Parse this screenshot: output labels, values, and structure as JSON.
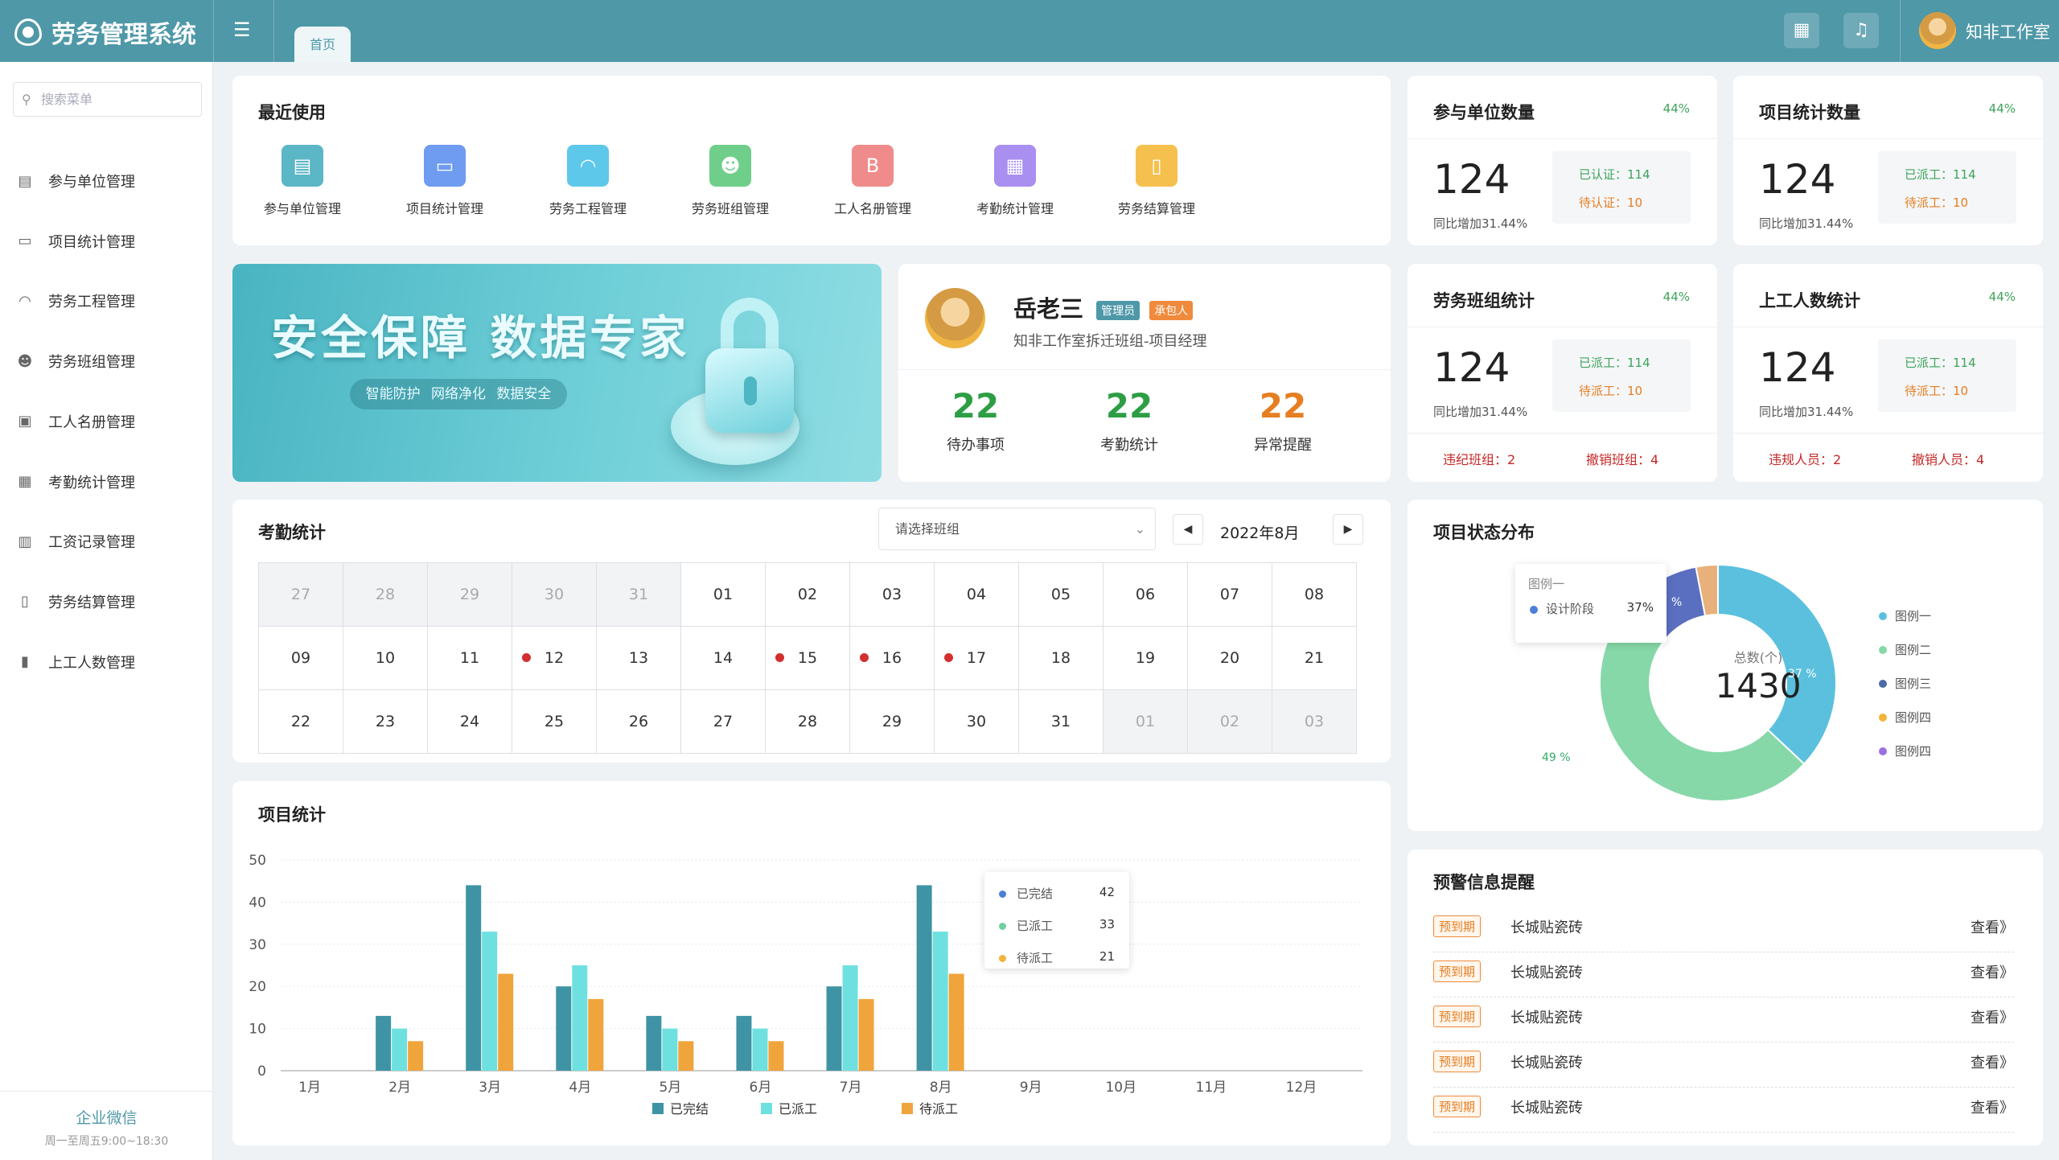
{
  "app": {
    "title": "劳务管理系统",
    "home_tab": "首页",
    "user_name": "知非工作室"
  },
  "sidebar": {
    "search_placeholder": "搜索菜单",
    "items": [
      {
        "label": "参与单位管理",
        "icon": "building-icon"
      },
      {
        "label": "项目统计管理",
        "icon": "folder-icon"
      },
      {
        "label": "劳务工程管理",
        "icon": "helmet-icon"
      },
      {
        "label": "劳务班组管理",
        "icon": "group-icon"
      },
      {
        "label": "工人名册管理",
        "icon": "roster-icon"
      },
      {
        "label": "考勤统计管理",
        "icon": "calendar-icon"
      },
      {
        "label": "工资记录管理",
        "icon": "salary-icon"
      },
      {
        "label": "劳务结算管理",
        "icon": "settlement-icon"
      },
      {
        "label": "上工人数管理",
        "icon": "bar-chart-icon"
      }
    ],
    "footer_title": "企业微信",
    "footer_hours": "周一至周五9:00~18:30"
  },
  "recent": {
    "title": "最近使用",
    "items": [
      {
        "label": "参与单位管理",
        "color": "#5bb6c6"
      },
      {
        "label": "项目统计管理",
        "color": "#6f9cf0"
      },
      {
        "label": "劳务工程管理",
        "color": "#5ec8ea"
      },
      {
        "label": "劳务班组管理",
        "color": "#6fcf8a"
      },
      {
        "label": "工人名册管理",
        "color": "#ef8b8b"
      },
      {
        "label": "考勤统计管理",
        "color": "#a88ff0"
      },
      {
        "label": "劳务结算管理",
        "color": "#f5c04d"
      }
    ]
  },
  "banner": {
    "title": "安全保障  数据专家",
    "pill": "智能防护 网络净化 数据安全"
  },
  "profile": {
    "name": "岳老三",
    "tag1": "管理员",
    "tag2": "承包人",
    "org": "知非工作室拆迁班组-项目经理",
    "stats": [
      {
        "value": "22",
        "label": "待办事项",
        "color": "#2e9e45"
      },
      {
        "value": "22",
        "label": "考勤统计",
        "color": "#2e9e45"
      },
      {
        "value": "22",
        "label": "异常提醒",
        "color": "#e67e22"
      }
    ]
  },
  "kpi": [
    {
      "title": "参与单位数量",
      "pct": "44%",
      "value": "124",
      "sub": "同比增加31.44%",
      "g": "已认证：114",
      "o": "待认证：10"
    },
    {
      "title": "项目统计数量",
      "pct": "44%",
      "value": "124",
      "sub": "同比增加31.44%",
      "g": "已派工：114",
      "o": "待派工：10"
    },
    {
      "title": "劳务班组统计",
      "pct": "44%",
      "value": "124",
      "sub": "同比增加31.44%",
      "g": "已派工：114",
      "o": "待派工：10",
      "b1": "违纪班组：2",
      "b2": "撤销班组：4"
    },
    {
      "title": "上工人数统计",
      "pct": "44%",
      "value": "124",
      "sub": "同比增加31.44%",
      "g": "已派工：114",
      "o": "待派工：10",
      "b1": "违规人员：2",
      "b2": "撤销人员：4"
    }
  ],
  "attendance": {
    "title": "考勤统计",
    "select_placeholder": "请选择班组",
    "month": "2022年8月",
    "rows": [
      [
        {
          "d": "27",
          "dim": true
        },
        {
          "d": "28",
          "dim": true
        },
        {
          "d": "29",
          "dim": true
        },
        {
          "d": "30",
          "dim": true
        },
        {
          "d": "31",
          "dim": true
        },
        {
          "d": "01"
        },
        {
          "d": "02"
        },
        {
          "d": "03"
        },
        {
          "d": "04"
        },
        {
          "d": "05"
        },
        {
          "d": "06"
        },
        {
          "d": "07"
        },
        {
          "d": "08"
        }
      ],
      [
        {
          "d": "09"
        },
        {
          "d": "10"
        },
        {
          "d": "11"
        },
        {
          "d": "12",
          "dot": true
        },
        {
          "d": "13"
        },
        {
          "d": "14"
        },
        {
          "d": "15",
          "dot": true
        },
        {
          "d": "16",
          "dot": true
        },
        {
          "d": "17",
          "dot": true
        },
        {
          "d": "18"
        },
        {
          "d": "19"
        },
        {
          "d": "20"
        },
        {
          "d": "21"
        }
      ],
      [
        {
          "d": "22"
        },
        {
          "d": "23"
        },
        {
          "d": "24"
        },
        {
          "d": "25"
        },
        {
          "d": "26"
        },
        {
          "d": "27"
        },
        {
          "d": "28"
        },
        {
          "d": "29"
        },
        {
          "d": "30"
        },
        {
          "d": "31"
        },
        {
          "d": "01",
          "dim": true
        },
        {
          "d": "02",
          "dim": true
        },
        {
          "d": "03",
          "dim": true
        }
      ]
    ]
  },
  "project_chart": {
    "title": "项目统计",
    "tooltip": [
      {
        "name": "已完结",
        "value": "42",
        "color": "#4a80d8"
      },
      {
        "name": "已派工",
        "value": "33",
        "color": "#6fd0a0"
      },
      {
        "name": "待派工",
        "value": "21",
        "color": "#f0b43c"
      }
    ]
  },
  "status": {
    "title": "项目状态分布",
    "center_label": "总数(个)",
    "center_value": "1430",
    "tooltip_title": "图例一",
    "tooltip_item": "设计阶段",
    "tooltip_pct": "37%",
    "label_blue": "37 %",
    "label_green": "49 %",
    "label_navy": "%",
    "legend": [
      {
        "name": "图例一",
        "color": "#5bc0de"
      },
      {
        "name": "图例二",
        "color": "#86d8a8"
      },
      {
        "name": "图例三",
        "color": "#4d6aa8"
      },
      {
        "name": "图例四",
        "color": "#f0b43c"
      },
      {
        "name": "图例四",
        "color": "#9b6fe0"
      }
    ]
  },
  "warnings": {
    "title": "预警信息提醒",
    "items": [
      {
        "tag": "预到期",
        "text": "长城贴瓷砖",
        "link": "查看》"
      },
      {
        "tag": "预到期",
        "text": "长城贴瓷砖",
        "link": "查看》"
      },
      {
        "tag": "预到期",
        "text": "长城贴瓷砖",
        "link": "查看》"
      },
      {
        "tag": "预到期",
        "text": "长城贴瓷砖",
        "link": "查看》"
      },
      {
        "tag": "预到期",
        "text": "长城贴瓷砖",
        "link": "查看》"
      }
    ]
  },
  "chart_data": [
    {
      "type": "bar",
      "title": "项目统计",
      "categories": [
        "1月",
        "2月",
        "3月",
        "4月",
        "5月",
        "6月",
        "7月",
        "8月",
        "9月",
        "10月",
        "11月",
        "12月"
      ],
      "ylim": [
        0,
        50
      ],
      "yticks": [
        0,
        10,
        20,
        30,
        40,
        50
      ],
      "grid": true,
      "legend_position": "bottom",
      "series": [
        {
          "name": "已完结",
          "color": "#3e93a4",
          "values": [
            0,
            13,
            44,
            20,
            13,
            13,
            20,
            44,
            0,
            0,
            0,
            0
          ]
        },
        {
          "name": "已派工",
          "color": "#6fe0e0",
          "values": [
            0,
            10,
            33,
            25,
            10,
            10,
            25,
            33,
            0,
            0,
            0,
            0
          ]
        },
        {
          "name": "待派工",
          "color": "#f0a43c",
          "values": [
            0,
            7,
            23,
            17,
            7,
            7,
            17,
            23,
            0,
            0,
            0,
            0
          ]
        }
      ]
    },
    {
      "type": "pie",
      "title": "项目状态分布",
      "center_label": "总数(个)",
      "total": "1430",
      "slices": [
        {
          "name": "图例一",
          "value": 37,
          "color": "#5bc0de"
        },
        {
          "name": "图例二",
          "value": 49,
          "color": "#86d8a8"
        },
        {
          "name": "图例三",
          "value": 11,
          "color": "#5b6fc0"
        },
        {
          "name": "图例四",
          "value": 3,
          "color": "#e8b07a"
        }
      ]
    }
  ]
}
